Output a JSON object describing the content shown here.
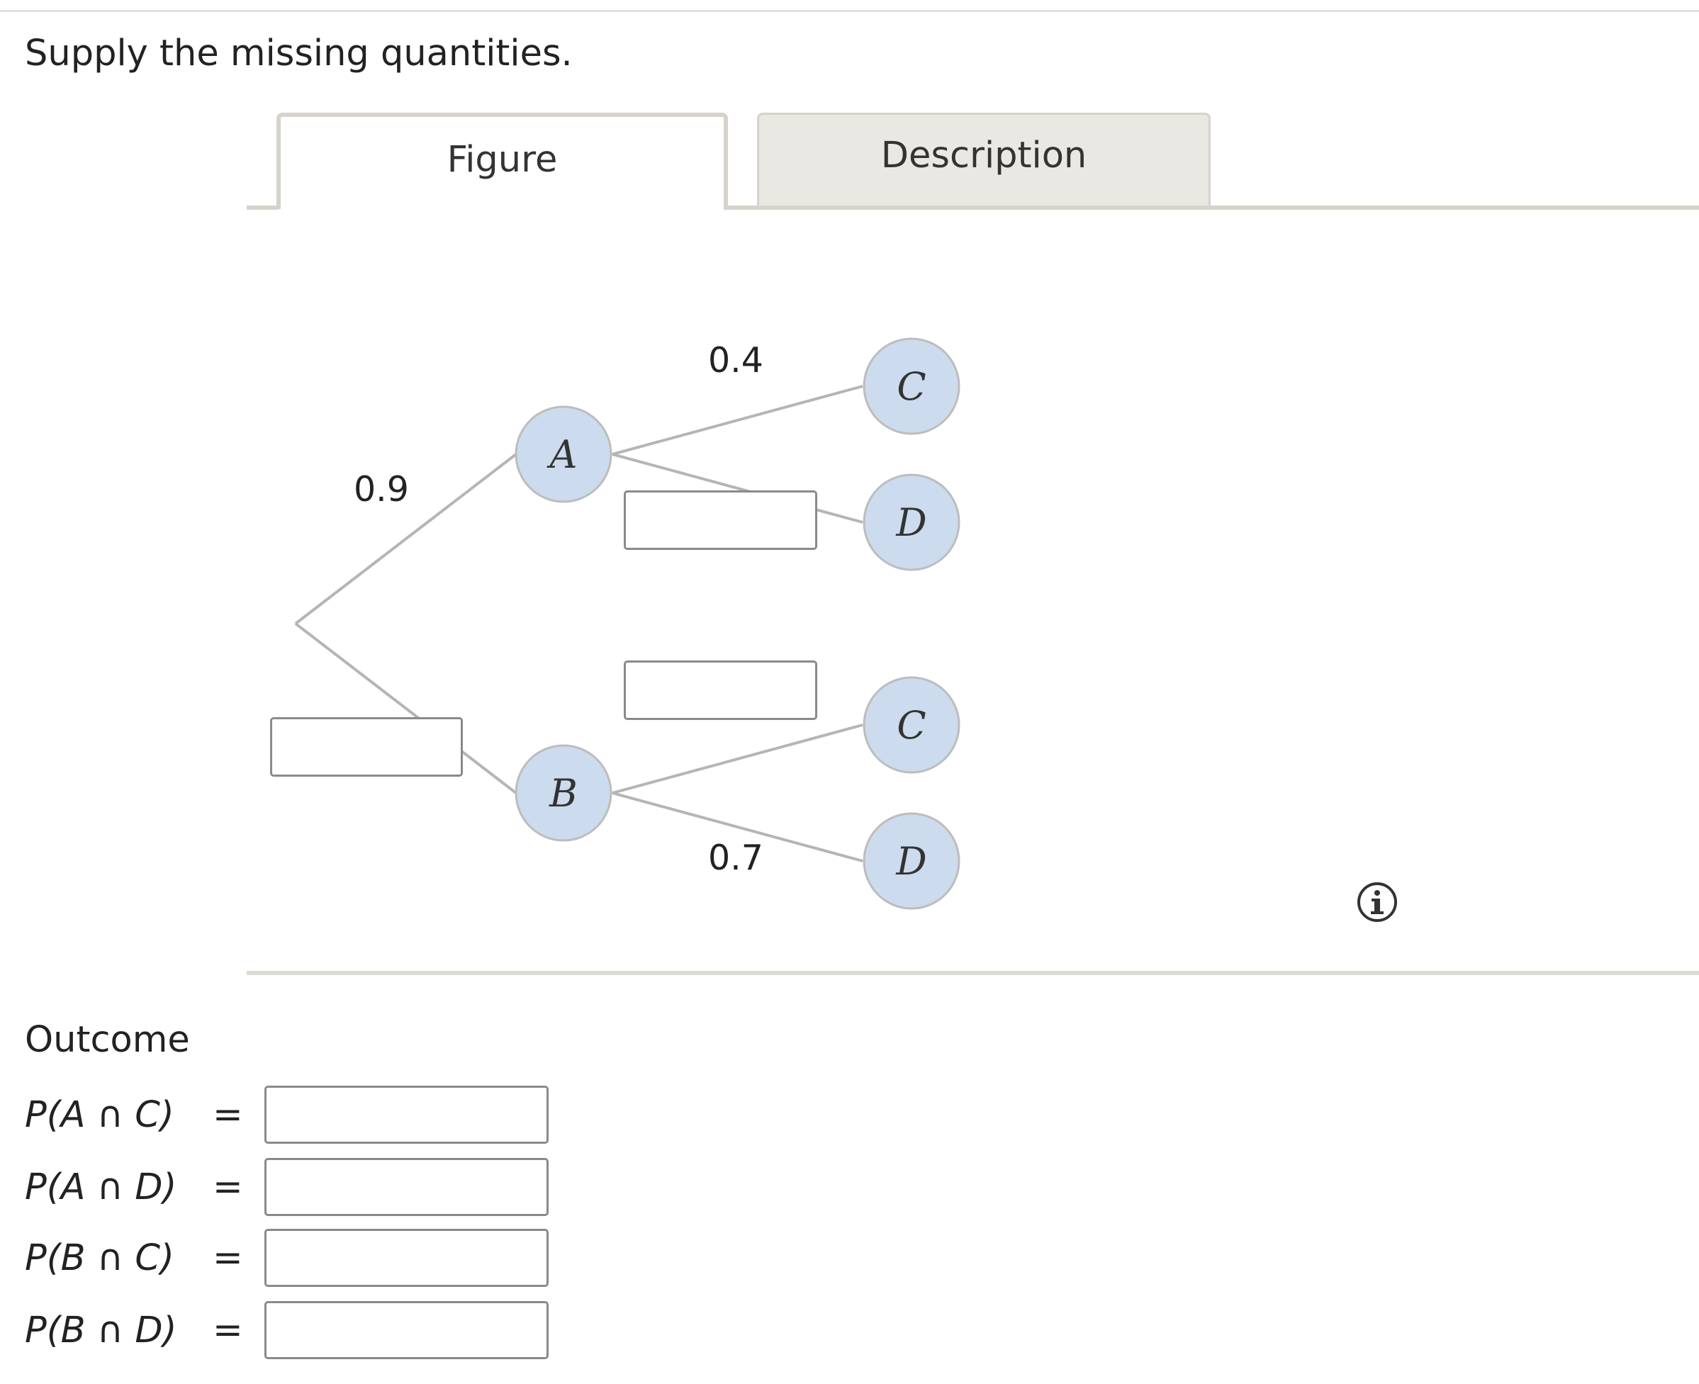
{
  "instruction": "Supply the missing quantities.",
  "tabs": {
    "figure_label": "Figure",
    "description_label": "Description",
    "selected": "Figure"
  },
  "tree": {
    "nodes": {
      "first_level": [
        "A",
        "B"
      ],
      "second_level_a": [
        "C",
        "D"
      ],
      "second_level_b": [
        "C",
        "D"
      ]
    },
    "branch_probabilities": {
      "root_to_A": "0.9",
      "root_to_B": "",
      "A_to_C": "0.4",
      "A_to_D": "",
      "B_to_C": "",
      "B_to_D": "0.7"
    },
    "node_fill": "#ccdbee",
    "node_stroke": "#bdbdbd",
    "edge_color": "#b5b5b5"
  },
  "info_icon": "info-icon",
  "outcome": {
    "heading": "Outcome",
    "rows": [
      {
        "expr": "P(A ∩ C)",
        "eq": "=",
        "value": ""
      },
      {
        "expr": "P(A ∩ D)",
        "eq": "=",
        "value": ""
      },
      {
        "expr": "P(B ∩ C)",
        "eq": "=",
        "value": ""
      },
      {
        "expr": "P(B ∩ D)",
        "eq": "=",
        "value": ""
      }
    ]
  }
}
